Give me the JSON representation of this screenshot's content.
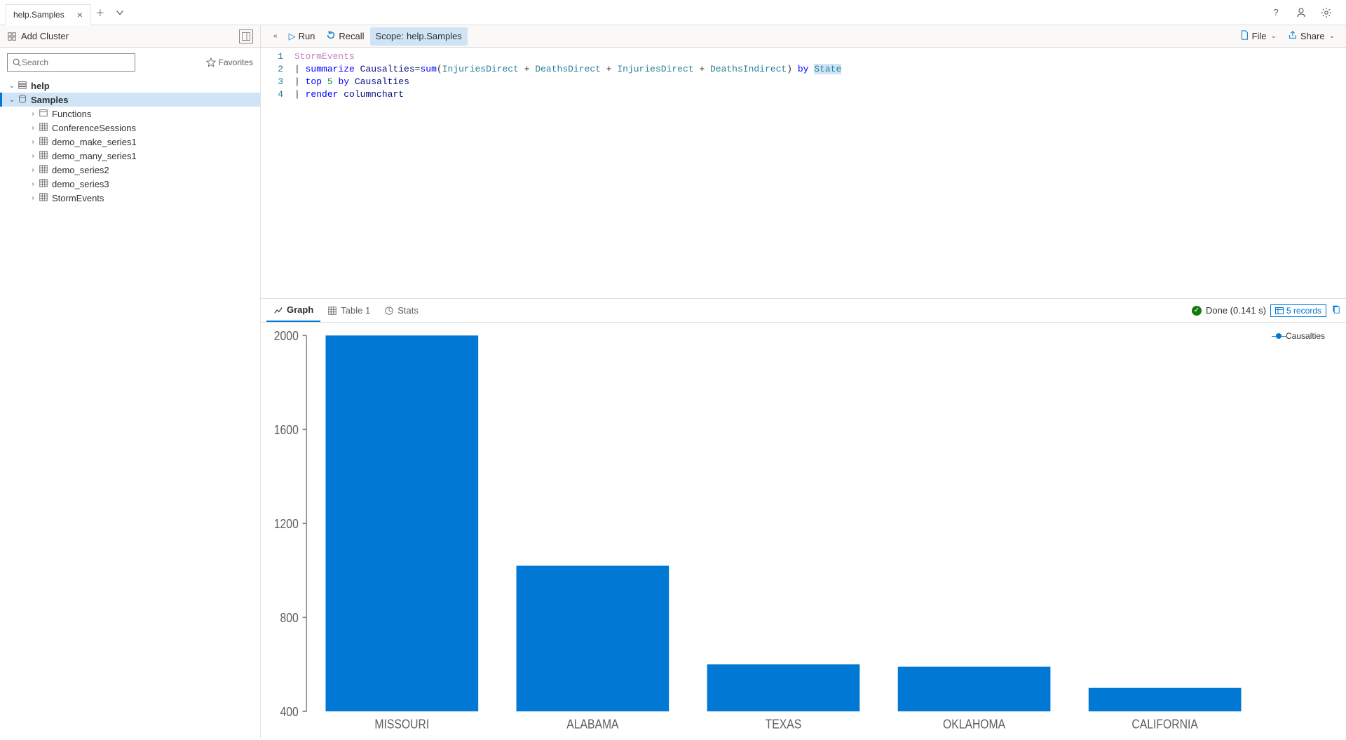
{
  "tab": {
    "title": "help.Samples"
  },
  "topright_icons": [
    "help-icon",
    "feedback-icon",
    "settings-icon"
  ],
  "sidebar": {
    "add_cluster": "Add Cluster",
    "search_placeholder": "Search",
    "favorites": "Favorites",
    "tree": {
      "cluster": "help",
      "database": "Samples",
      "items": [
        {
          "label": "Functions",
          "type": "functions"
        },
        {
          "label": "ConferenceSessions",
          "type": "table"
        },
        {
          "label": "demo_make_series1",
          "type": "table"
        },
        {
          "label": "demo_many_series1",
          "type": "table"
        },
        {
          "label": "demo_series2",
          "type": "table"
        },
        {
          "label": "demo_series3",
          "type": "table"
        },
        {
          "label": "StormEvents",
          "type": "table"
        }
      ]
    }
  },
  "toolbar": {
    "run": "Run",
    "recall": "Recall",
    "scope_prefix": "Scope: ",
    "scope_value": "help.Samples",
    "file": "File",
    "share": "Share"
  },
  "editor": {
    "lines": [
      "1",
      "2",
      "3",
      "4"
    ],
    "line1_table": "StormEvents",
    "line2_summarize": "summarize",
    "line2_assign": "Causalties",
    "line2_eq": "=",
    "line2_sum": "sum",
    "line2_open": "(",
    "line2_c1": "InjuriesDirect",
    "line2_plus": " + ",
    "line2_c2": "DeathsDirect",
    "line2_c3": "InjuriesDirect",
    "line2_c4": "DeathsIndirect",
    "line2_close": ")",
    "line2_by": "by",
    "line2_state": "State",
    "line3_top": "top",
    "line3_n": "5",
    "line3_by": "by",
    "line3_col": "Causalties",
    "line4_render": "render",
    "line4_type": "columnchart",
    "pipe": "| "
  },
  "results": {
    "tabs": {
      "graph": "Graph",
      "table": "Table 1",
      "stats": "Stats"
    },
    "status_done": "Done (0.141 s)",
    "records": "5 records"
  },
  "legend": {
    "series": "Causalties"
  },
  "chart_data": {
    "type": "bar",
    "categories": [
      "MISSOURI",
      "ALABAMA",
      "TEXAS",
      "OKLAHOMA",
      "CALIFORNIA"
    ],
    "values": [
      2000,
      1020,
      600,
      590,
      500
    ],
    "xlabel": "",
    "ylabel": "",
    "ylim": [
      400,
      2000
    ],
    "yticks": [
      400,
      800,
      1200,
      1600,
      2000
    ],
    "series_name": "Causalties"
  }
}
